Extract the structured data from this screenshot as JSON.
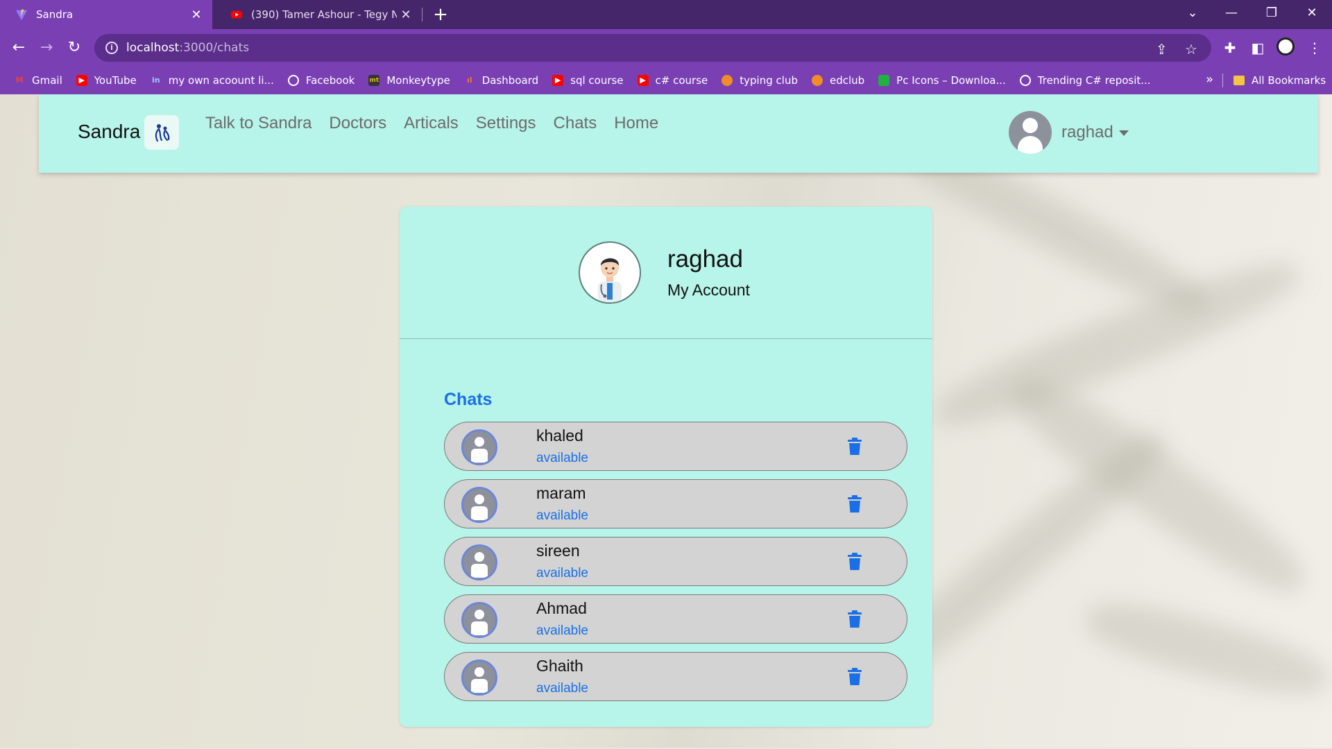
{
  "browser": {
    "tabs": [
      {
        "title": "Sandra",
        "active": true,
        "icon": "vite-logo-icon"
      },
      {
        "title": "(390) Tamer Ashour - Tegy Ntrah",
        "active": false,
        "icon": "youtube-icon"
      }
    ],
    "url_host": "localhost",
    "url_path": ":3000/chats",
    "bookmarks": [
      {
        "label": "Gmail",
        "icon": "gmail-icon",
        "color": "#ea4335"
      },
      {
        "label": "YouTube",
        "icon": "youtube-icon",
        "color": "#ff0000"
      },
      {
        "label": "my own acoount li...",
        "icon": "linkedin-icon",
        "color": "#0a66c2"
      },
      {
        "label": "Facebook",
        "icon": "globe-icon",
        "color": "#ffffff"
      },
      {
        "label": "Monkeytype",
        "icon": "monkeytype-icon",
        "color": "#323437"
      },
      {
        "label": "Dashboard",
        "icon": "dashboard-icon",
        "color": "#f47c20"
      },
      {
        "label": "sql course",
        "icon": "youtube-icon",
        "color": "#ff0000"
      },
      {
        "label": "c# course",
        "icon": "youtube-icon",
        "color": "#ff0000"
      },
      {
        "label": "typing club",
        "icon": "typingclub-icon",
        "color": "#f28c28"
      },
      {
        "label": "edclub",
        "icon": "edclub-icon",
        "color": "#f28c28"
      },
      {
        "label": "Pc Icons – Downloa...",
        "icon": "icons8-icon",
        "color": "#1fb141"
      },
      {
        "label": "Trending C# reposit...",
        "icon": "globe-icon",
        "color": "#ffffff"
      }
    ],
    "all_bookmarks": "All Bookmarks"
  },
  "navbar": {
    "brand": "Sandra",
    "links": [
      "Talk to Sandra",
      "Doctors",
      "Articals",
      "Settings",
      "Chats",
      "Home"
    ],
    "user": "raghad"
  },
  "profile": {
    "name": "raghad",
    "subtitle": "My Account"
  },
  "chats": {
    "title": "Chats",
    "items": [
      {
        "name": "khaled",
        "status": "available"
      },
      {
        "name": "maram",
        "status": "available"
      },
      {
        "name": "sireen",
        "status": "available"
      },
      {
        "name": "Ahmad",
        "status": "available"
      },
      {
        "name": "Ghaith",
        "status": "available"
      }
    ]
  },
  "colors": {
    "chrome": "#7b3fb4",
    "navbar_bg": "#b7f4e9",
    "accent_blue": "#1a6fe6",
    "chat_item_bg": "#d3d3d3"
  }
}
